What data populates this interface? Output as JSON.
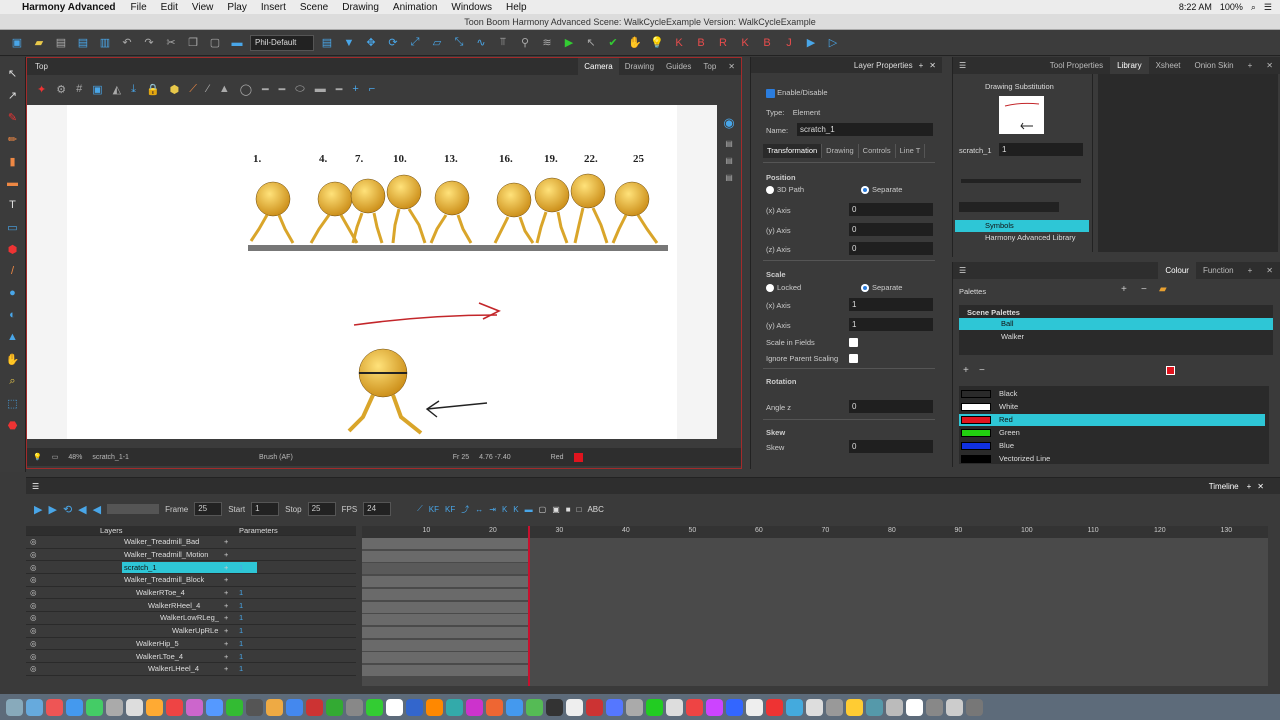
{
  "menubar": {
    "app": "Harmony Advanced",
    "items": [
      "File",
      "Edit",
      "View",
      "Play",
      "Insert",
      "Scene",
      "Drawing",
      "Animation",
      "Windows",
      "Help"
    ],
    "time": "8:22 AM",
    "battery": "100%"
  },
  "window_title": "Toon Boom Harmony Advanced Scene: WalkCycleExample Version: WalkCycleExample",
  "toolbar": {
    "preset": "Phil-Default"
  },
  "camera": {
    "title": "Top",
    "tabs": [
      "Camera",
      "Drawing",
      "Guides",
      "Top"
    ],
    "active_tab": "Camera",
    "frame_numbers": [
      "1.",
      "4.",
      "7.",
      "10.",
      "13.",
      "16.",
      "19.",
      "22.",
      "25"
    ],
    "status": {
      "zoom": "48%",
      "drawing": "scratch_1-1",
      "tool": "Brush (AF)",
      "frame": "Fr 25",
      "coords": "4.76 -7.40",
      "color": "Red"
    }
  },
  "layer_properties": {
    "header": "Layer Properties",
    "enable_label": "Enable/Disable",
    "type_label": "Type:",
    "type_value": "Element",
    "name_label": "Name:",
    "name_value": "scratch_1",
    "tabs": [
      "Transformation",
      "Drawing",
      "Controls",
      "Line T"
    ],
    "position_header": "Position",
    "path_3d": "3D Path",
    "separate": "Separate",
    "x_axis": "(x) Axis",
    "y_axis": "(y) Axis",
    "z_axis": "(z) Axis",
    "pos_x": "0",
    "pos_y": "0",
    "pos_z": "0",
    "scale_header": "Scale",
    "locked": "Locked",
    "scale_x": "1",
    "scale_y": "1",
    "scale_in_fields": "Scale in Fields",
    "ignore_parent": "Ignore Parent Scaling",
    "rotation_header": "Rotation",
    "angle_label": "Angle z",
    "angle_value": "0",
    "skew_header": "Skew",
    "skew_label": "Skew",
    "skew_value": "0"
  },
  "library": {
    "tabs": [
      "Tool Properties",
      "Library",
      "Xsheet",
      "Onion Skin"
    ],
    "active_tab": "Library",
    "drawing_substitution": "Drawing Substitution",
    "drawing_name": "scratch_1",
    "drawing_value": "1",
    "tree": [
      "Symbols",
      "Harmony Advanced Library"
    ]
  },
  "colour": {
    "tabs": [
      "Colour",
      "Function"
    ],
    "palettes_label": "Palettes",
    "scene_palettes": "Scene Palettes",
    "palette_list": [
      "Ball",
      "Walker"
    ],
    "swatches": [
      {
        "name": "Black",
        "color": "#000000"
      },
      {
        "name": "White",
        "color": "#ffffff"
      },
      {
        "name": "Red",
        "color": "#e0141e"
      },
      {
        "name": "Green",
        "color": "#22d010"
      },
      {
        "name": "Blue",
        "color": "#1030e0"
      },
      {
        "name": "Vectorized Line",
        "color": "#000000"
      }
    ]
  },
  "timeline": {
    "title": "Timeline",
    "frame_label": "Frame",
    "frame": "25",
    "start_label": "Start",
    "start": "1",
    "stop_label": "Stop",
    "stop": "25",
    "fps_label": "FPS",
    "fps": "24",
    "layers_header": "Layers",
    "params_header": "Parameters",
    "ruler": [
      "10",
      "20",
      "30",
      "40",
      "50",
      "60",
      "70",
      "80",
      "90",
      "100",
      "110",
      "120",
      "130"
    ],
    "current_frame": 25,
    "layers": [
      {
        "name": "Walker_Treadmill_Bad",
        "param": ""
      },
      {
        "name": "Walker_Treadmill_Motion",
        "param": ""
      },
      {
        "name": "scratch_1",
        "param": "1"
      },
      {
        "name": "Walker_Treadmill_Block",
        "param": ""
      },
      {
        "name": "WalkerRToe_4",
        "param": "1"
      },
      {
        "name": "WalkerRHeel_4",
        "param": "1"
      },
      {
        "name": "WalkerLowRLeg_",
        "param": "1"
      },
      {
        "name": "WalkerUpRLe",
        "param": "1"
      },
      {
        "name": "WalkerHip_5",
        "param": "1"
      },
      {
        "name": "WalkerLToe_4",
        "param": "1"
      },
      {
        "name": "WalkerLHeel_4",
        "param": "1"
      }
    ]
  }
}
